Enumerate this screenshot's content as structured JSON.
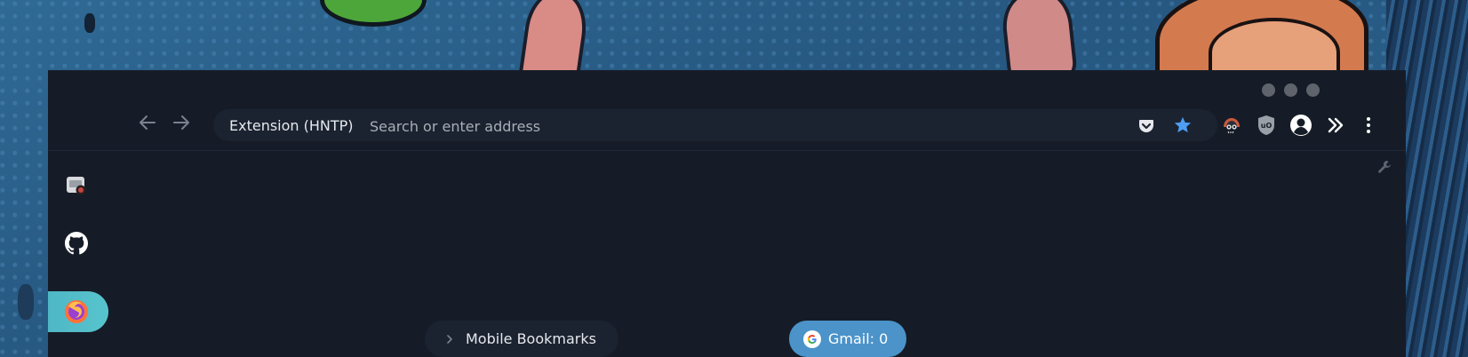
{
  "colors": {
    "window_bg": "#161c27",
    "urlbar_bg": "#1b2331",
    "star_accent": "#4c9df3",
    "side_active": "#4fb7c6",
    "gmail_pill": "#4b93c9"
  },
  "window_controls": [
    "minimize-dot",
    "maximize-dot",
    "close-dot"
  ],
  "toolbar": {
    "back_icon": "arrow-left-icon",
    "forward_icon": "arrow-right-icon",
    "site_label": "Extension (HNTP)",
    "address_placeholder": "Search or enter address",
    "address_value": "",
    "pocket_icon": "pocket-icon",
    "bookmark_star_icon": "star-icon",
    "extensions": [
      "privacy-badger-icon",
      "ublock-origin-icon",
      "account-icon"
    ],
    "overflow_icon": "double-chevron-icon",
    "menu_icon": "kebab-menu-icon"
  },
  "content": {
    "settings_icon": "wrench-icon",
    "sidebar": [
      {
        "name": "screen-capture-icon"
      },
      {
        "name": "github-icon"
      },
      {
        "name": "firefox-icon",
        "active": true
      }
    ],
    "bookmarks_pill": {
      "icon": "chevron-right-icon",
      "label": "Mobile Bookmarks"
    },
    "gmail_pill": {
      "icon": "google-icon",
      "label": "Gmail: 0"
    }
  }
}
